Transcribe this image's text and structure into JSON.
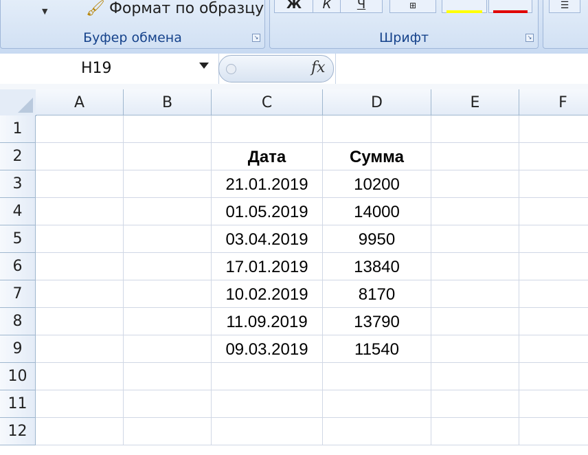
{
  "ribbon": {
    "clipboard_group": {
      "label": "Буфер обмена",
      "format_painter": "Формат по образцу"
    },
    "font_group": {
      "label": "Шрифт",
      "bold": "Ж",
      "italic": "К",
      "underline": "Ч",
      "fill_color": "#ffff00",
      "font_color": "#e00000"
    }
  },
  "formula_bar": {
    "name_box": "H19",
    "fx": "fx",
    "formula": ""
  },
  "sheet": {
    "columns": [
      "A",
      "B",
      "C",
      "D",
      "E",
      "F"
    ],
    "row_numbers": [
      "1",
      "2",
      "3",
      "4",
      "5",
      "6",
      "7",
      "8",
      "9",
      "10",
      "11",
      "12"
    ],
    "header": {
      "date": "Дата",
      "sum": "Сумма"
    },
    "data": [
      {
        "date": "21.01.2019",
        "sum": "10200"
      },
      {
        "date": "01.05.2019",
        "sum": "14000"
      },
      {
        "date": "03.04.2019",
        "sum": "9950"
      },
      {
        "date": "17.01.2019",
        "sum": "13840"
      },
      {
        "date": "10.02.2019",
        "sum": "8170"
      },
      {
        "date": "11.09.2019",
        "sum": "13790"
      },
      {
        "date": "09.03.2019",
        "sum": "11540"
      }
    ]
  }
}
